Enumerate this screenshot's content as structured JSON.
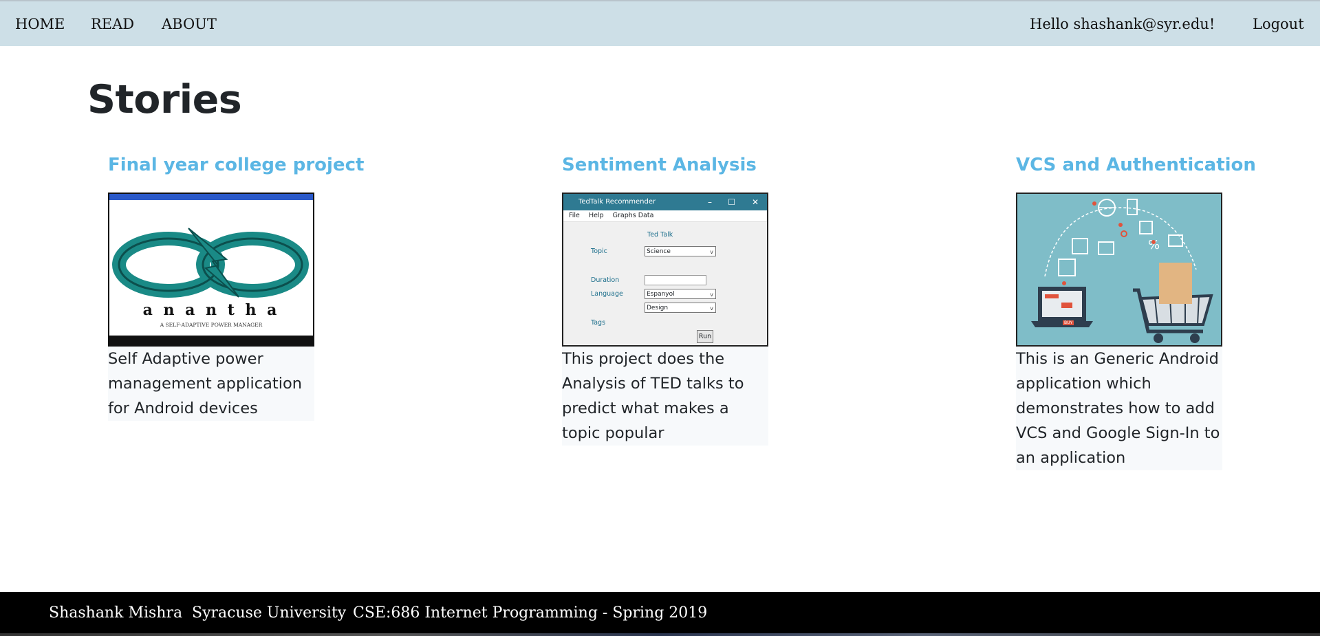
{
  "nav": {
    "links": [
      "HOME",
      "READ",
      "ABOUT"
    ],
    "greeting": "Hello shashank@syr.edu!",
    "logout": "Logout"
  },
  "page": {
    "title": "Stories"
  },
  "stories": [
    {
      "title": "Final year college project",
      "description": "Self Adaptive power management application for Android devices",
      "image": {
        "logo_text": "a n a n t h a",
        "tagline": "A SELF-ADAPTIVE POWER MANAGER"
      }
    },
    {
      "title": "Sentiment Analysis",
      "description": "This project does the Analysis of TED talks to predict what makes a topic popular",
      "image": {
        "window_title": "TedTalk Recommender",
        "menu": [
          "File",
          "Help",
          "Graphs Data"
        ],
        "heading": "Ted Talk",
        "labels": {
          "topic": "Topic",
          "duration": "Duration",
          "language": "Language",
          "tags": "Tags"
        },
        "topic_value": "Science",
        "language_value": "Espanyol",
        "category_value": "Design",
        "run_button": "Run"
      }
    },
    {
      "title": "VCS and Authentication",
      "description": "This is an Generic Android application which demonstrates how to add VCS and Google Sign-In to an application",
      "image": {
        "badge_text": "BUY"
      }
    }
  ],
  "footer": {
    "name": "Shashank Mishra",
    "university": "Syracuse University",
    "course": "CSE:686 Internet Programming - Spring 2019"
  },
  "colors": {
    "navbar_bg": "#cddfe7",
    "card_title": "#5bb6e4",
    "footer_bg": "#000000",
    "ecommerce_bg": "#7fbdc8",
    "app_titlebar": "#2f7a92"
  },
  "icons": [
    "close-icon",
    "minimize-icon",
    "maximize-icon",
    "shopping-cart-icon",
    "laptop-icon",
    "globe-icon"
  ]
}
